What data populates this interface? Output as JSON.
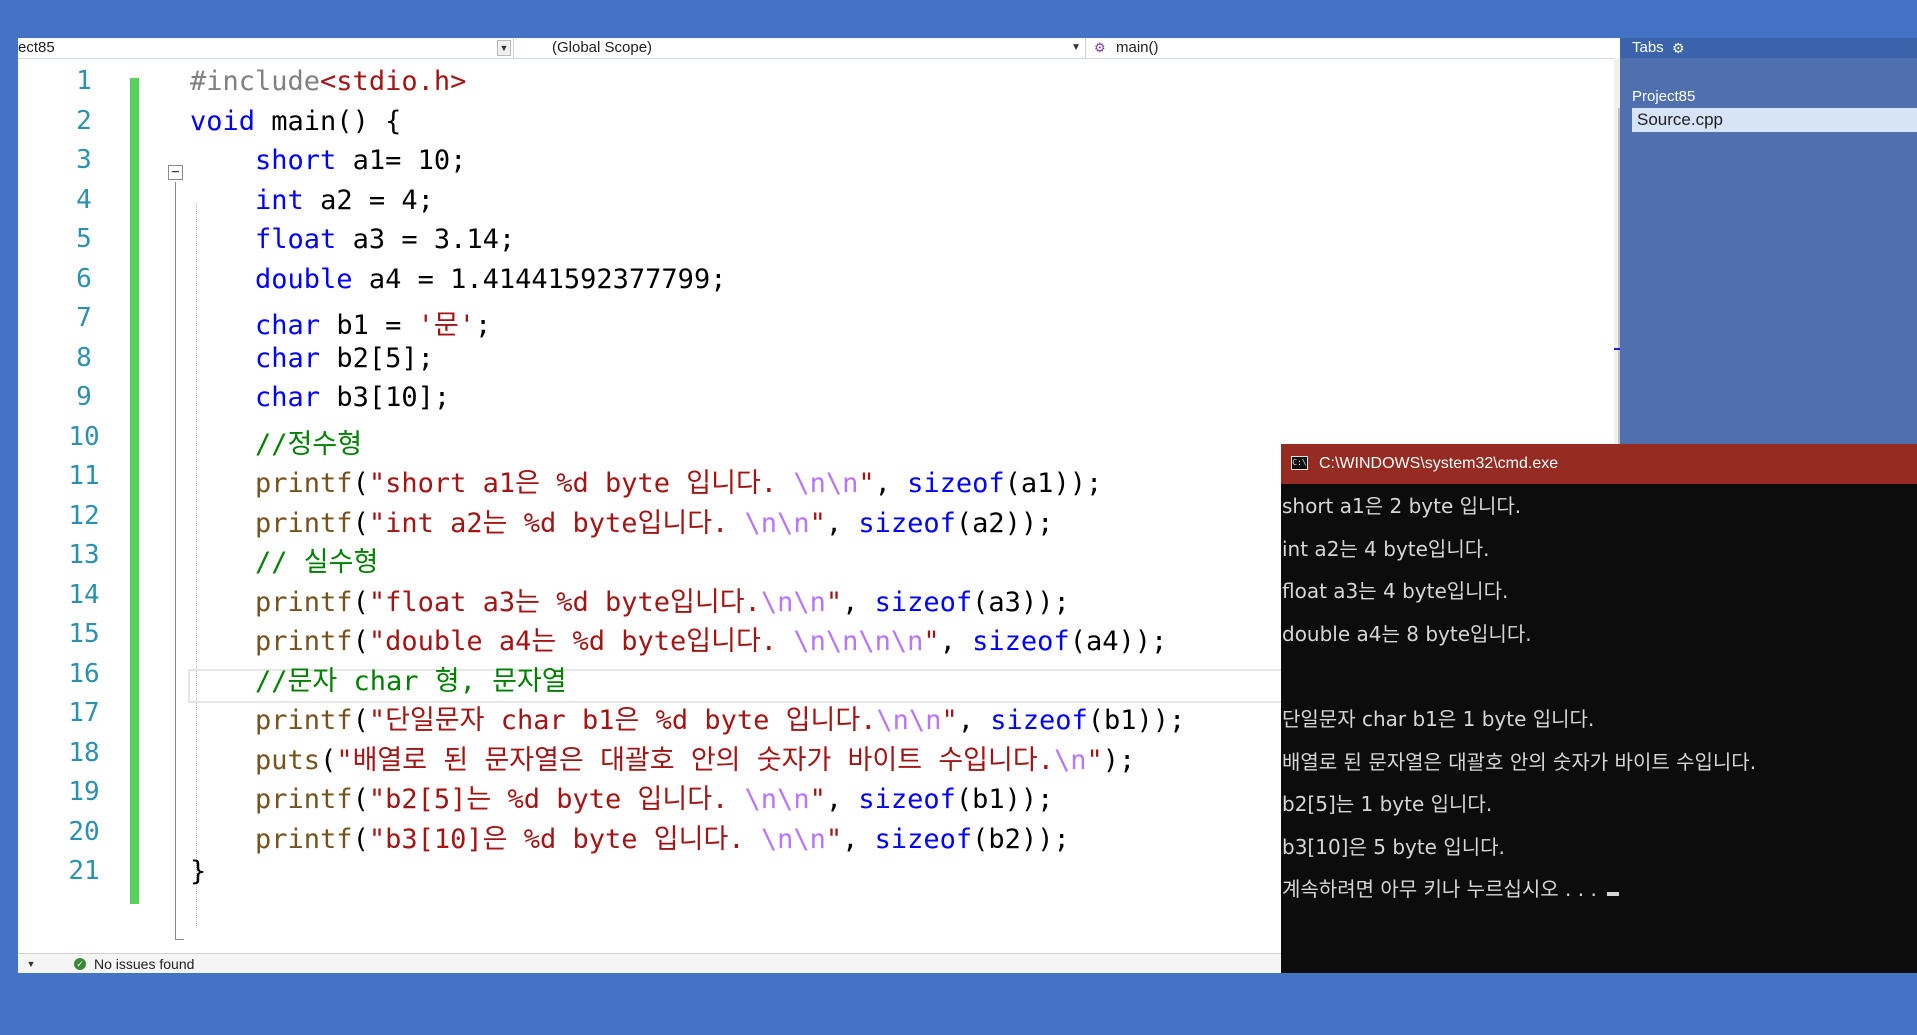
{
  "navbar": {
    "project_combo": "ect85",
    "scope_combo": "(Global Scope)",
    "member_combo": "main()"
  },
  "editor": {
    "line_numbers": [
      "1",
      "2",
      "3",
      "4",
      "5",
      "6",
      "7",
      "8",
      "9",
      "10",
      "11",
      "12",
      "13",
      "14",
      "15",
      "16",
      "17",
      "18",
      "19",
      "20",
      "21"
    ],
    "lines": [
      [
        {
          "t": "#include",
          "c": "pp"
        },
        {
          "t": "<stdio.h>",
          "c": "st"
        }
      ],
      [
        {
          "t": "void",
          "c": "kw"
        },
        {
          "t": " main() {",
          "c": ""
        }
      ],
      [
        {
          "t": "    ",
          "c": ""
        },
        {
          "t": "short",
          "c": "kw"
        },
        {
          "t": " a1= 10;",
          "c": ""
        }
      ],
      [
        {
          "t": "    ",
          "c": ""
        },
        {
          "t": "int",
          "c": "kw"
        },
        {
          "t": " a2 = 4;",
          "c": ""
        }
      ],
      [
        {
          "t": "    ",
          "c": ""
        },
        {
          "t": "float",
          "c": "kw"
        },
        {
          "t": " a3 = 3.14;",
          "c": ""
        }
      ],
      [
        {
          "t": "    ",
          "c": ""
        },
        {
          "t": "double",
          "c": "kw"
        },
        {
          "t": " a4 = 1.41441592377799;",
          "c": ""
        }
      ],
      [
        {
          "t": "    ",
          "c": ""
        },
        {
          "t": "char",
          "c": "kw"
        },
        {
          "t": " b1 = ",
          "c": ""
        },
        {
          "t": "'문'",
          "c": "st"
        },
        {
          "t": ";",
          "c": ""
        }
      ],
      [
        {
          "t": "    ",
          "c": ""
        },
        {
          "t": "char",
          "c": "kw"
        },
        {
          "t": " b2[5];",
          "c": ""
        }
      ],
      [
        {
          "t": "    ",
          "c": ""
        },
        {
          "t": "char",
          "c": "kw"
        },
        {
          "t": " b3[10];",
          "c": ""
        }
      ],
      [
        {
          "t": "    ",
          "c": ""
        },
        {
          "t": "//정수형",
          "c": "cm"
        }
      ],
      [
        {
          "t": "    ",
          "c": ""
        },
        {
          "t": "printf",
          "c": "fn"
        },
        {
          "t": "(",
          "c": ""
        },
        {
          "t": "\"short a1은 %d byte 입니다. ",
          "c": "st"
        },
        {
          "t": "\\n\\n",
          "c": "esc"
        },
        {
          "t": "\"",
          "c": "st"
        },
        {
          "t": ", ",
          "c": ""
        },
        {
          "t": "sizeof",
          "c": "kw"
        },
        {
          "t": "(a1));",
          "c": ""
        }
      ],
      [
        {
          "t": "    ",
          "c": ""
        },
        {
          "t": "printf",
          "c": "fn"
        },
        {
          "t": "(",
          "c": ""
        },
        {
          "t": "\"int a2는 %d byte입니다. ",
          "c": "st"
        },
        {
          "t": "\\n\\n",
          "c": "esc"
        },
        {
          "t": "\"",
          "c": "st"
        },
        {
          "t": ", ",
          "c": ""
        },
        {
          "t": "sizeof",
          "c": "kw"
        },
        {
          "t": "(a2));",
          "c": ""
        }
      ],
      [
        {
          "t": "    ",
          "c": ""
        },
        {
          "t": "// 실수형",
          "c": "cm"
        }
      ],
      [
        {
          "t": "    ",
          "c": ""
        },
        {
          "t": "printf",
          "c": "fn"
        },
        {
          "t": "(",
          "c": ""
        },
        {
          "t": "\"float a3는 %d byte입니다.",
          "c": "st"
        },
        {
          "t": "\\n\\n",
          "c": "esc"
        },
        {
          "t": "\"",
          "c": "st"
        },
        {
          "t": ", ",
          "c": ""
        },
        {
          "t": "sizeof",
          "c": "kw"
        },
        {
          "t": "(a3));",
          "c": ""
        }
      ],
      [
        {
          "t": "    ",
          "c": ""
        },
        {
          "t": "printf",
          "c": "fn"
        },
        {
          "t": "(",
          "c": ""
        },
        {
          "t": "\"double a4는 %d byte입니다. ",
          "c": "st"
        },
        {
          "t": "\\n\\n\\n\\n",
          "c": "esc"
        },
        {
          "t": "\"",
          "c": "st"
        },
        {
          "t": ", ",
          "c": ""
        },
        {
          "t": "sizeof",
          "c": "kw"
        },
        {
          "t": "(a4));",
          "c": ""
        }
      ],
      [
        {
          "t": "    ",
          "c": ""
        },
        {
          "t": "//문자 char 형, 문자열",
          "c": "cm"
        }
      ],
      [
        {
          "t": "    ",
          "c": ""
        },
        {
          "t": "printf",
          "c": "fn"
        },
        {
          "t": "(",
          "c": ""
        },
        {
          "t": "\"단일문자 char b1은 %d byte 입니다.",
          "c": "st"
        },
        {
          "t": "\\n\\n",
          "c": "esc"
        },
        {
          "t": "\"",
          "c": "st"
        },
        {
          "t": ", ",
          "c": ""
        },
        {
          "t": "sizeof",
          "c": "kw"
        },
        {
          "t": "(b1));",
          "c": ""
        }
      ],
      [
        {
          "t": "    ",
          "c": ""
        },
        {
          "t": "puts",
          "c": "fn"
        },
        {
          "t": "(",
          "c": ""
        },
        {
          "t": "\"배열로 된 문자열은 대괄호 안의 숫자가 바이트 수입니다.",
          "c": "st"
        },
        {
          "t": "\\n",
          "c": "esc"
        },
        {
          "t": "\"",
          "c": "st"
        },
        {
          "t": ");",
          "c": ""
        }
      ],
      [
        {
          "t": "    ",
          "c": ""
        },
        {
          "t": "printf",
          "c": "fn"
        },
        {
          "t": "(",
          "c": ""
        },
        {
          "t": "\"b2[5]는 %d byte 입니다. ",
          "c": "st"
        },
        {
          "t": "\\n\\n",
          "c": "esc"
        },
        {
          "t": "\"",
          "c": "st"
        },
        {
          "t": ", ",
          "c": ""
        },
        {
          "t": "sizeof",
          "c": "kw"
        },
        {
          "t": "(b1));",
          "c": ""
        }
      ],
      [
        {
          "t": "    ",
          "c": ""
        },
        {
          "t": "printf",
          "c": "fn"
        },
        {
          "t": "(",
          "c": ""
        },
        {
          "t": "\"b3[10]은 %d byte 입니다. ",
          "c": "st"
        },
        {
          "t": "\\n\\n",
          "c": "esc"
        },
        {
          "t": "\"",
          "c": "st"
        },
        {
          "t": ", ",
          "c": ""
        },
        {
          "t": "sizeof",
          "c": "kw"
        },
        {
          "t": "(b2));",
          "c": ""
        }
      ],
      [
        {
          "t": "}",
          "c": ""
        }
      ]
    ],
    "colors": {
      "keyword": "#0000ff",
      "string": "#a31515",
      "comment": "#008000",
      "preprocessor": "#808080",
      "function": "#74531f",
      "escape": "#b776fb",
      "line_number": "#2b91af",
      "change_bar": "#57d15c"
    }
  },
  "statusbar": {
    "issues": "No issues found"
  },
  "solution_explorer": {
    "header_label": "Tabs",
    "project": "Project85",
    "file": "Source.cpp"
  },
  "console": {
    "title": "C:\\WINDOWS\\system32\\cmd.exe",
    "lines": [
      "short a1은 2 byte 입니다.",
      "int a2는 4 byte입니다.",
      "float a3는 4 byte입니다.",
      "double a4는 8 byte입니다.",
      "",
      "단일문자 char b1은 1 byte 입니다.",
      "배열로 된 문자열은 대괄호 안의 숫자가 바이트 수입니다.",
      "b2[5]는 1 byte 입니다.",
      "b3[10]은 5 byte 입니다.",
      "계속하려면 아무 키나 누르십시오 . . . "
    ],
    "title_bar_color": "#962b22",
    "background_color": "#0c0c0c"
  }
}
